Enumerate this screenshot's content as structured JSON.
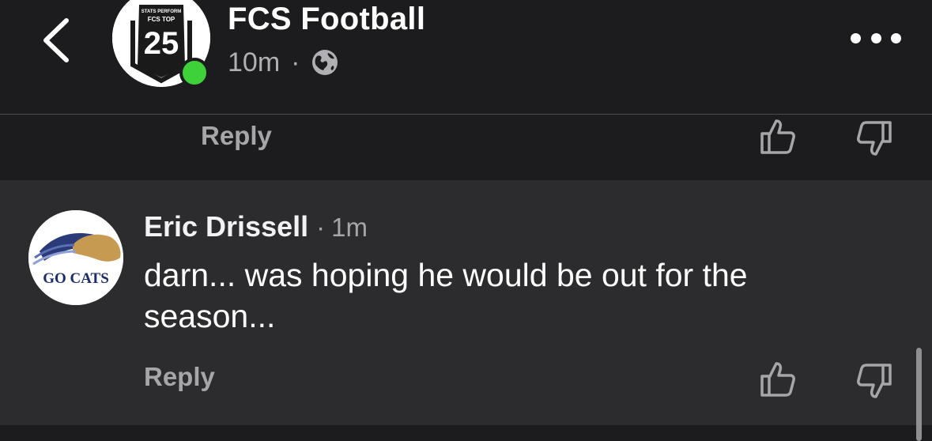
{
  "header": {
    "page_name": "FCS Football",
    "post_time": "10m",
    "separator": "·",
    "audience_icon": "globe-icon",
    "avatar_text_top": "STATS PERFORM",
    "avatar_text_mid": "FCS TOP",
    "avatar_number": "25",
    "online_status_color": "#3fd13a"
  },
  "previous_comment": {
    "reply_label": "Reply"
  },
  "comment": {
    "author": "Eric Drissell",
    "separator": "·",
    "time": "1m",
    "text": "darn... was hoping he would be out for the season...",
    "reply_label": "Reply",
    "avatar_text": "GO CATS"
  },
  "colors": {
    "background": "#1c1c1e",
    "card": "#2c2c2e",
    "muted_text": "#a6a6aa",
    "accent_online": "#3fd13a"
  }
}
